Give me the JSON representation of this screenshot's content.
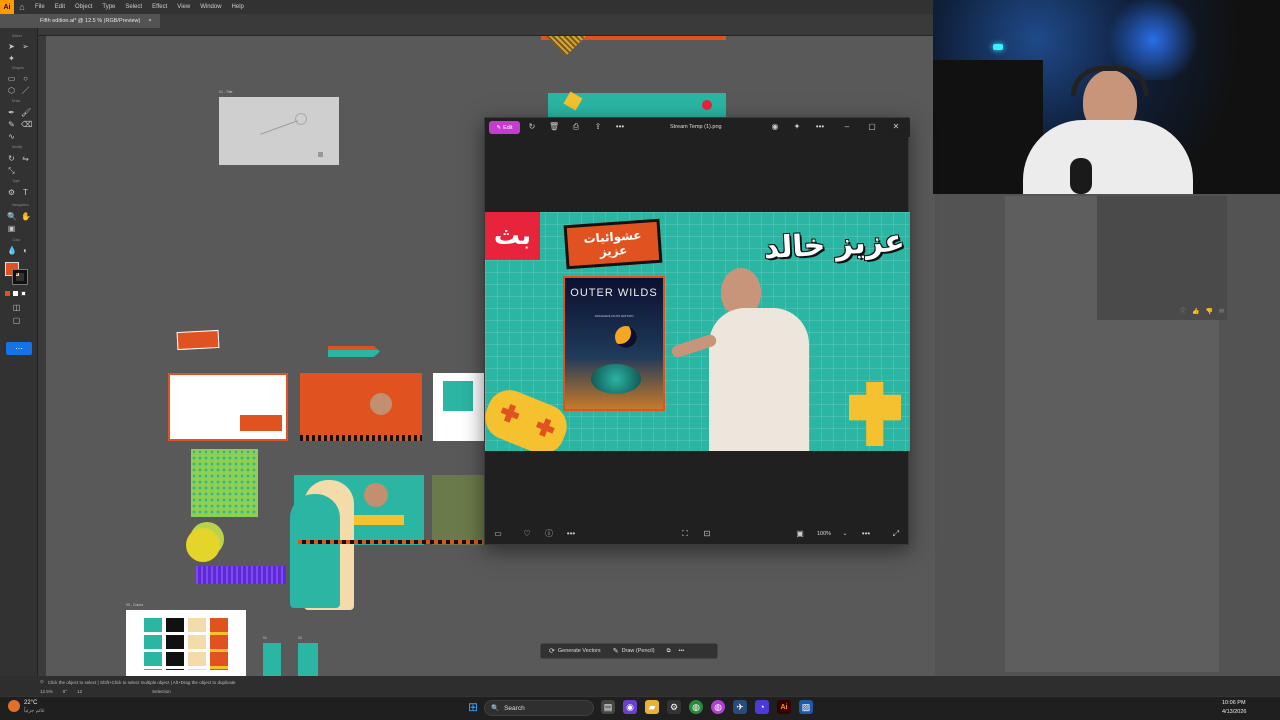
{
  "app": {
    "menu": [
      "File",
      "Edit",
      "Object",
      "Type",
      "Select",
      "Effect",
      "View",
      "Window",
      "Help"
    ],
    "doc_tab": "Fifth edition.ai* @ 12.5 % (RGB/Preview)",
    "doc_tab_close": "×",
    "tool_sections": [
      "Select",
      "Shapes",
      "Draw",
      "Modify",
      "Type",
      "Navigation",
      "Color"
    ],
    "status_text": "Click the object to select  |  Shift+Click to select multiple object  |  Alt+Drag the object to duplicate",
    "zoom": "12.5%",
    "rotation": "0°",
    "artboard_nav": "12",
    "selection": "Selection"
  },
  "artboards": {
    "title": "01 - Title",
    "colors": "09 - Colors",
    "a1": "01",
    "a2": "02",
    "a3": "03",
    "a4": "04"
  },
  "context_bar": {
    "generate": "Generate Vectors",
    "draw": "Draw (Pencil)",
    "more": "•••"
  },
  "viewer": {
    "edit_label": "Edit",
    "title": "Stream Temp (1).png",
    "zoom": "100%",
    "more": "•••",
    "thumb_text_1": "بث",
    "thumb_text_2": "عشوائيات",
    "thumb_text_3": "عزيز",
    "thumb_text_4": "عزيز خالد",
    "game_title": "OUTER WILDS",
    "game_sub": "ARCHAEOLOGIST EDITION"
  },
  "taskbar": {
    "weather_temp": "22°C",
    "weather_sub": "غائم جزئياً",
    "search_placeholder": "Search",
    "time": "10:06 PM",
    "date": "4/13/2026"
  },
  "colors": {
    "accent": "#c63ccf",
    "teal": "#2bb5a3",
    "orange": "#e0521f",
    "red": "#e8233c",
    "yellow": "#f5c12e"
  }
}
